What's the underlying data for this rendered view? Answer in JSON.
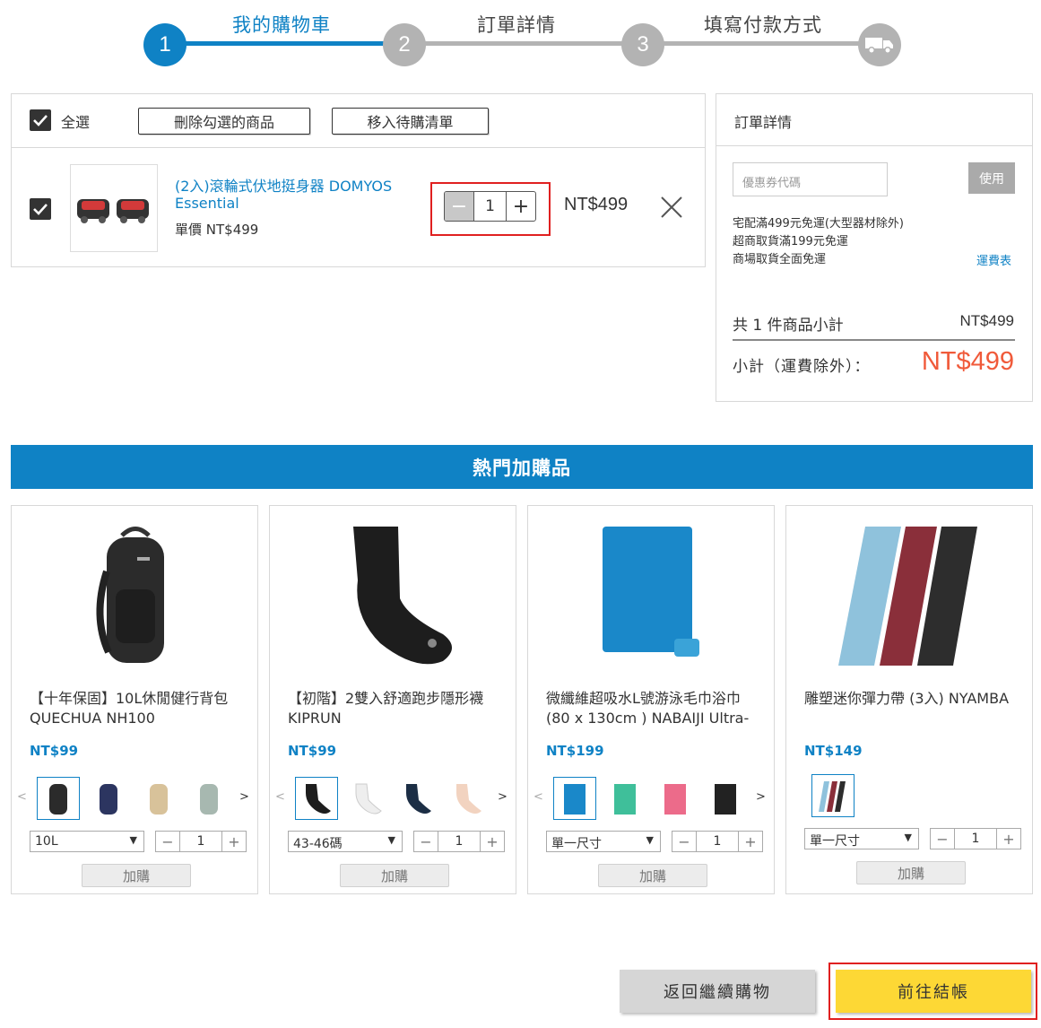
{
  "stepper": {
    "steps": [
      {
        "number": "1",
        "label": "我的購物車",
        "state": "active"
      },
      {
        "number": "2",
        "label": "訂單詳情",
        "state": "inactive"
      },
      {
        "number": "3",
        "label": "填寫付款方式",
        "state": "inactive"
      }
    ],
    "final_icon": "truck-icon",
    "colors": {
      "active": "#0f82c5",
      "inactive": "#b3b3b3"
    }
  },
  "cart": {
    "select_all_label": "全選",
    "delete_selected_label": "刪除勾選的商品",
    "move_to_wishlist_label": "移入待購清單",
    "items": [
      {
        "name": "(2入)滾輪式伏地挺身器 DOMYOS Essential",
        "unit_price": "單價 NT$499",
        "quantity": "1",
        "total": "NT$499",
        "checked": true
      }
    ]
  },
  "summary": {
    "title": "訂單詳情",
    "coupon_placeholder": "優惠券代碼",
    "use_label": "使用",
    "shipping_notes": [
      "宅配滿499元免運(大型器材除外)",
      "超商取貨滿199元免運",
      "商場取貨全面免運"
    ],
    "shipping_table_link": "運費表",
    "items_subtotal_label": "共 1 件商品小計",
    "items_subtotal_value": "NT$499",
    "subtotal_label": "小計（運費除外）：",
    "subtotal_value": "NT$499",
    "accent_color": "#f05a3a"
  },
  "recommend": {
    "title": "熱門加購品",
    "add_label": "加購",
    "products": [
      {
        "name": "【十年保固】10L休閒健行背包 QUECHUA NH100",
        "price": "NT$99",
        "option": "10L",
        "qty": "1",
        "swatches": [
          "black",
          "navy",
          "beige",
          "sage"
        ]
      },
      {
        "name": "【初階】2雙入舒適跑步隱形襪 KIPRUN",
        "price": "NT$99",
        "option": "43-46碼",
        "qty": "1",
        "swatches": [
          "black",
          "white",
          "navy",
          "peach"
        ]
      },
      {
        "name": "微纖維超吸水L號游泳毛巾浴巾 (80 x 130cm ) NABAIJI Ultra-",
        "price": "NT$199",
        "option": "單一尺寸",
        "qty": "1",
        "swatches": [
          "blue",
          "green",
          "pink",
          "black"
        ]
      },
      {
        "name": "雕塑迷你彈力帶 (3入) NYAMBA",
        "price": "NT$149",
        "option": "單一尺寸",
        "qty": "1",
        "swatches": [
          "multi"
        ]
      }
    ]
  },
  "footer": {
    "back_label": "返回繼續購物",
    "checkout_label": "前往結帳"
  }
}
